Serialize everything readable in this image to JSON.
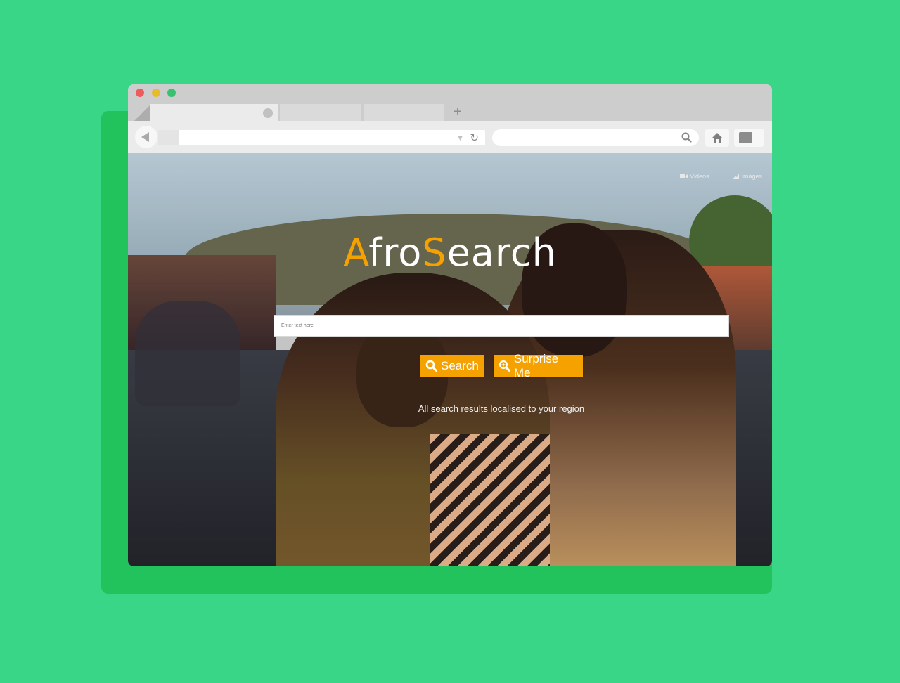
{
  "colors": {
    "background": "#39d688",
    "accent": "#f5a100"
  },
  "browser": {
    "tabs": [
      "",
      "",
      ""
    ],
    "new_tab_icon": "+",
    "url": "",
    "search_value": ""
  },
  "nav": {
    "videos_label": "Videos",
    "images_label": "Images"
  },
  "logo": {
    "part1_accent": "A",
    "part2": "fro",
    "part3_accent": "S",
    "part4": "earch"
  },
  "search": {
    "placeholder": "Enter text here",
    "search_button": "Search",
    "surprise_button": "Surprise Me"
  },
  "tagline": "All search results localised to your region"
}
